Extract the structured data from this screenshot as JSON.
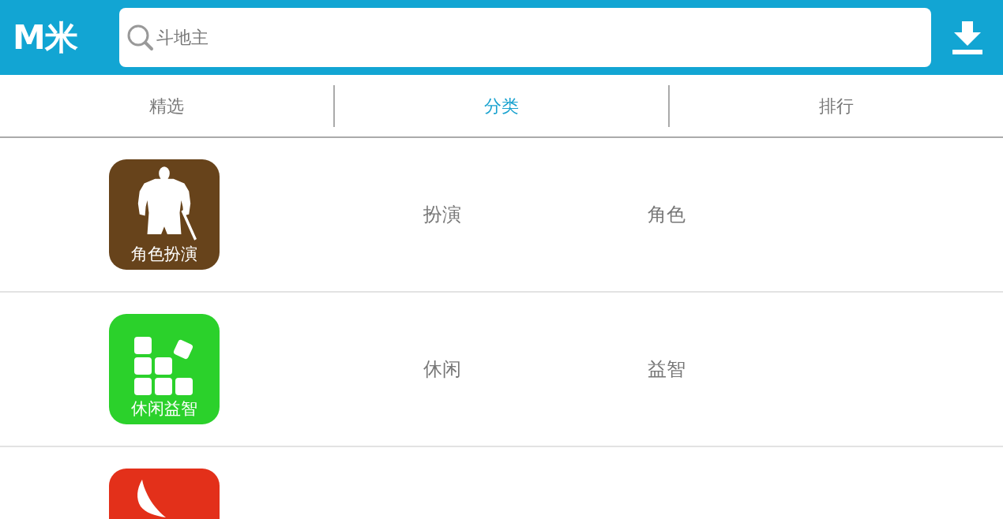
{
  "header": {
    "logo": "M米",
    "search": {
      "placeholder": "斗地主"
    }
  },
  "tabs": [
    {
      "label": "精选",
      "selected": false
    },
    {
      "label": "分类",
      "selected": true
    },
    {
      "label": "排行",
      "selected": false
    }
  ],
  "categories": [
    {
      "kind": "warrior",
      "color": "#67431b",
      "tile_label": "角色扮演",
      "tags": [
        "扮演",
        "角色"
      ]
    },
    {
      "kind": "blocks",
      "color": "#2bd12b",
      "tile_label": "休闲益智",
      "tags": [
        "休闲",
        "益智"
      ]
    },
    {
      "kind": "blade",
      "color": "#e3301a"
    }
  ]
}
